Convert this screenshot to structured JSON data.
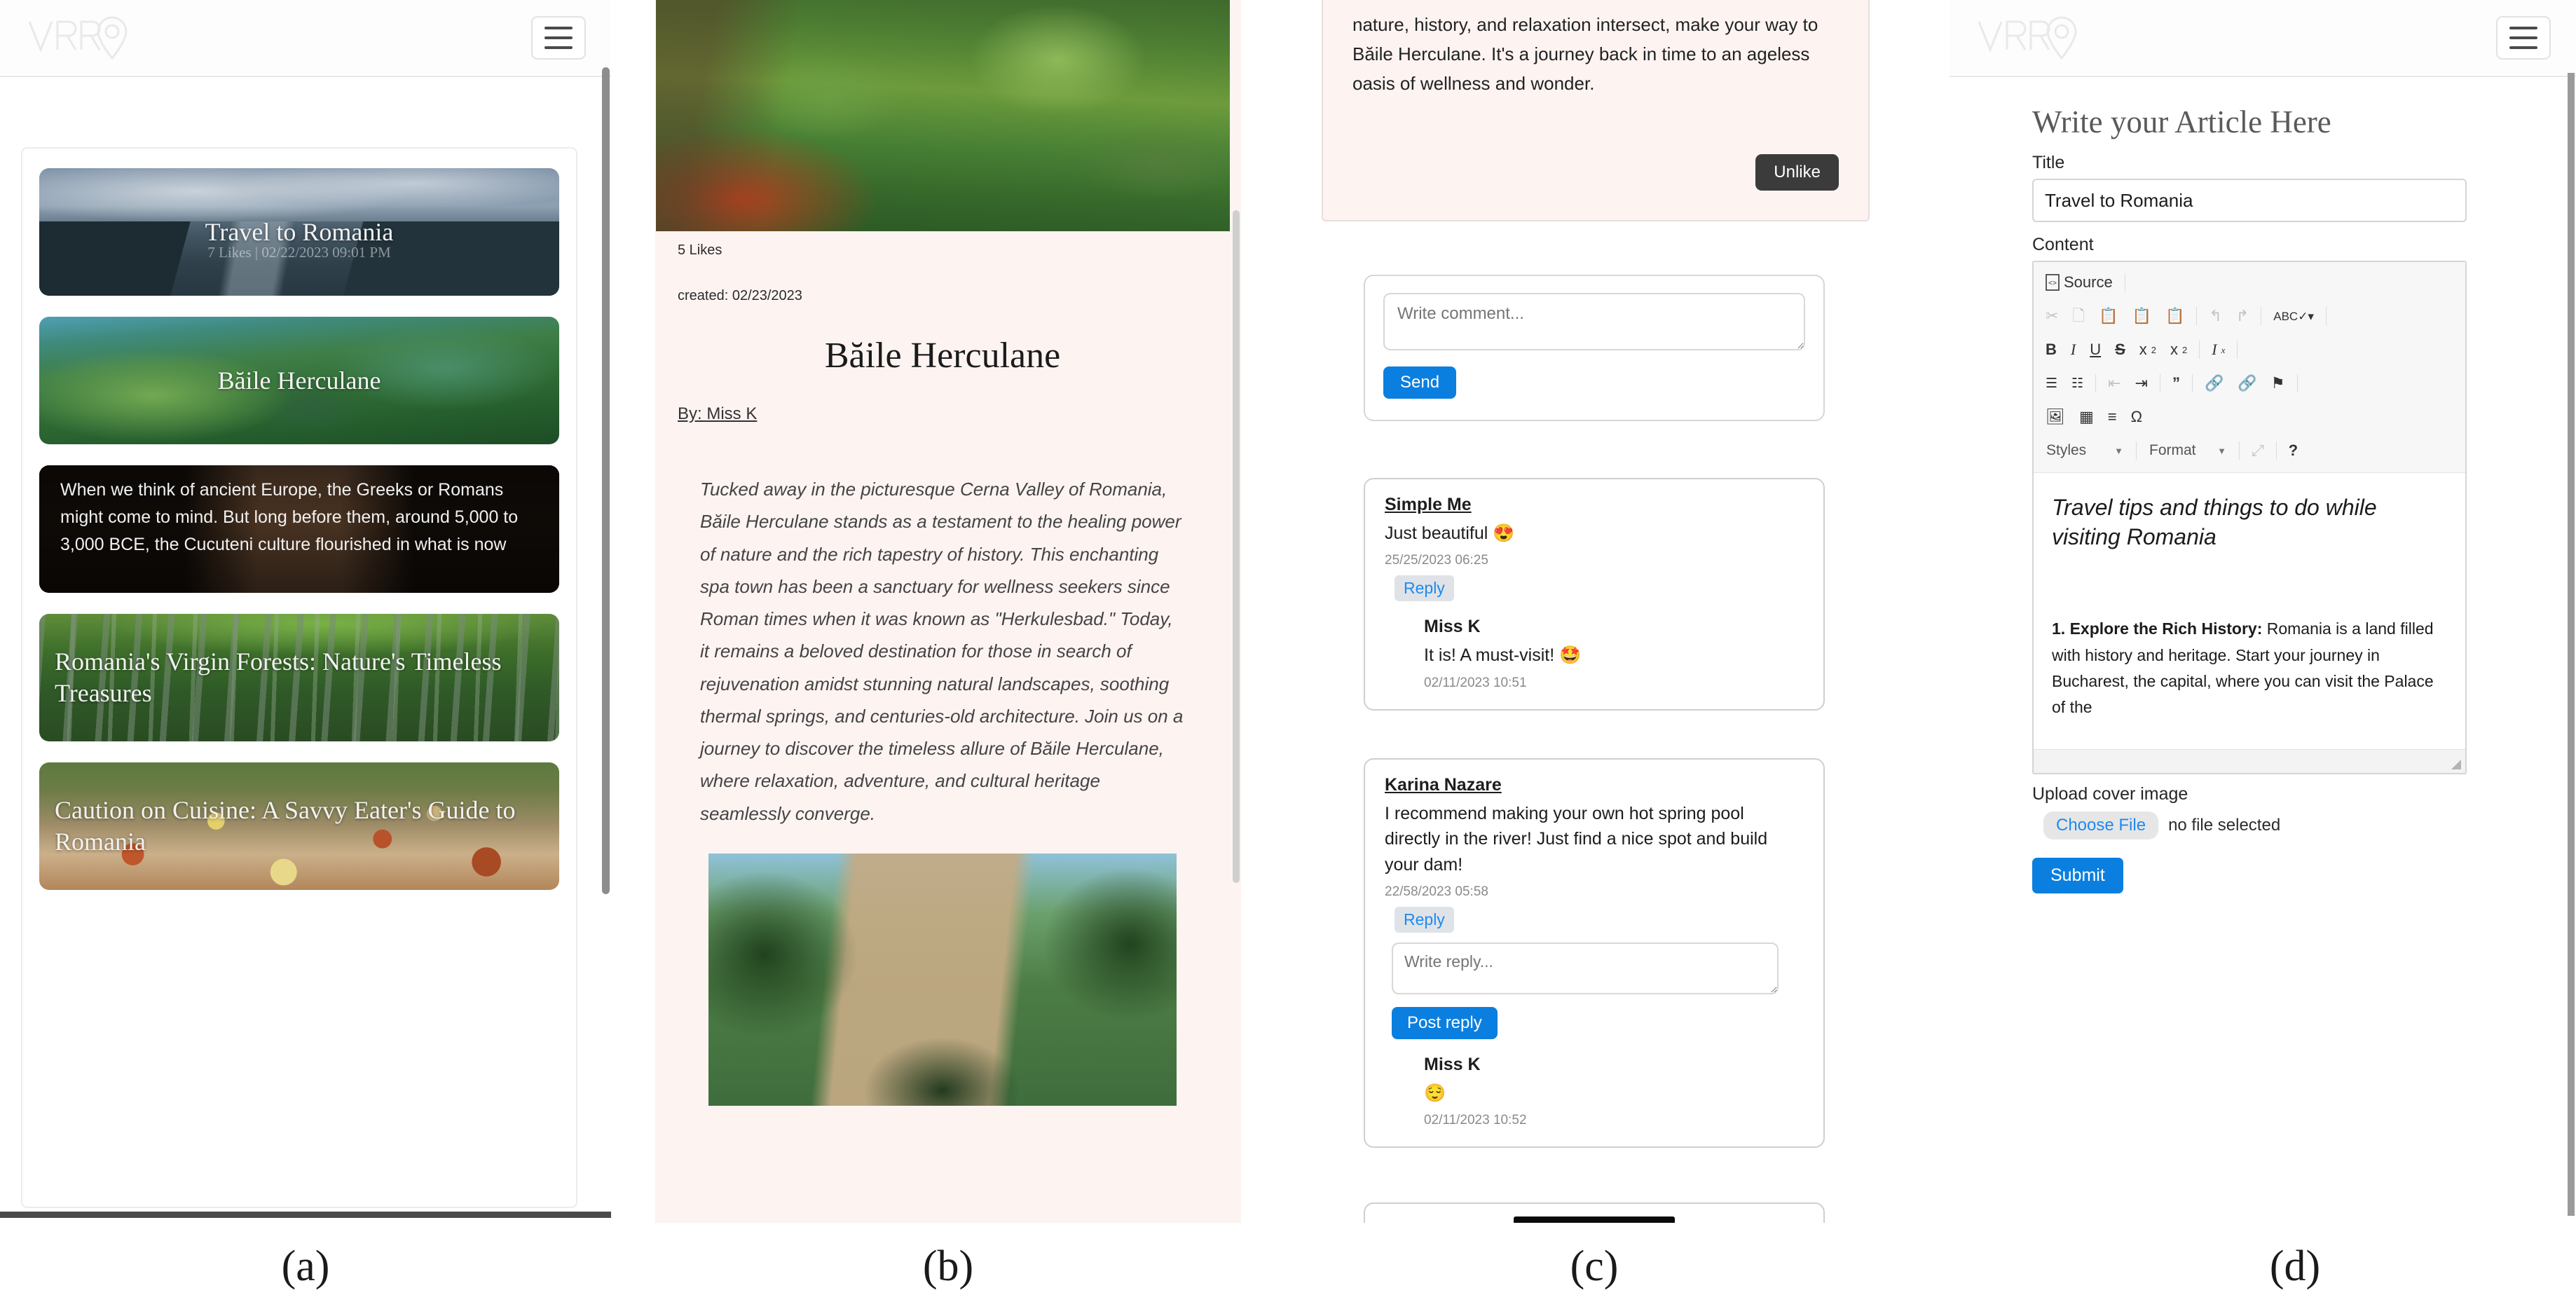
{
  "brand": {
    "logo_text": "VRRO",
    "logo_icon": "map-pin-logo"
  },
  "panel_captions": [
    "(a)",
    "(b)",
    "(c)",
    "(d)"
  ],
  "panel_a": {
    "nav": {
      "logo": "VRRO",
      "menu_icon": "hamburger-menu-icon"
    },
    "tiles": [
      {
        "title": "Travel to Romania",
        "meta": "7 Likes | 02/22/2023 09:01 PM",
        "kind": "photo",
        "align": "center"
      },
      {
        "title": "Băile Herculane",
        "meta": "",
        "kind": "photo",
        "align": "center"
      },
      {
        "title": "When we think of ancient Europe, the Greeks or Romans might come to mind. But long before them, around 5,000 to 3,000 BCE, the Cucuteni culture flourished in what is now",
        "kind": "dark-text"
      },
      {
        "title": "Romania's Virgin Forests: Nature's Timeless Treasures",
        "meta": "",
        "kind": "photo",
        "align": "left"
      },
      {
        "title": "Caution on Cuisine: A Savvy Eater's Guide to Romania",
        "meta": "",
        "kind": "photo",
        "align": "left"
      }
    ]
  },
  "panel_b": {
    "likes": "5 Likes",
    "created": "created: 02/23/2023",
    "title": "Băile Herculane",
    "author": "By: Miss K",
    "body": "Tucked away in the picturesque Cerna Valley of Romania, Băile Herculane stands as a testament to the healing power of nature and the rich tapestry of history. This enchanting spa town has been a sanctuary for wellness seekers since Roman times when it was known as \"Herkulesbad.\" Today, it remains a beloved destination for those in search of rejuvenation amidst stunning natural landscapes, soothing thermal springs, and centuries-old architecture. Join us on a journey to discover the timeless allure of Băile Herculane, where relaxation, adventure, and cultural heritage seamlessly converge."
  },
  "panel_c": {
    "article_tail": "nature, history, and relaxation intersect, make your way to Băile Herculane. It's a journey back in time to an ageless oasis of wellness and wonder.",
    "unlike_label": "Unlike",
    "comment_placeholder": "Write comment...",
    "send_label": "Send",
    "comments": [
      {
        "author": "Simple Me",
        "text": "Just beautiful 😍",
        "time": "25/25/2023 06:25",
        "reply_label": "Reply",
        "replies": [
          {
            "author": "Miss K",
            "text": "It is! A must-visit! 🤩",
            "time": "02/11/2023 10:51"
          }
        ]
      },
      {
        "author": "Karina Nazare",
        "text": "I recommend making your own hot spring pool directly in the river! Just find a nice spot and build your dam!",
        "time": "22/58/2023 05:58",
        "reply_label": "Reply",
        "reply_placeholder": "Write reply...",
        "post_reply_label": "Post reply",
        "replies": [
          {
            "author": "Miss K",
            "text": "😌",
            "time": "02/11/2023 10:52"
          }
        ]
      }
    ]
  },
  "panel_d": {
    "nav": {
      "logo": "VRRO",
      "menu_icon": "hamburger-menu-icon"
    },
    "heading": "Write your Article Here",
    "title_label": "Title",
    "title_value": "Travel to Romania",
    "content_label": "Content",
    "toolbar": {
      "source_label": "Source",
      "row_clipboard": [
        "cut-icon",
        "copy-icon",
        "paste-icon",
        "paste-text-icon",
        "paste-word-icon",
        "undo-icon",
        "redo-icon",
        "spellcheck-icon"
      ],
      "row_format": [
        "bold-icon",
        "italic-icon",
        "underline-icon",
        "strikethrough-icon",
        "subscript-icon",
        "superscript-icon",
        "remove-format-icon"
      ],
      "row_lists": [
        "numbered-list-icon",
        "bulleted-list-icon",
        "decrease-indent-icon",
        "increase-indent-icon",
        "blockquote-icon",
        "link-icon",
        "unlink-icon",
        "anchor-icon"
      ],
      "row_insert": [
        "image-icon",
        "table-icon",
        "horizontal-rule-icon",
        "special-char-icon"
      ],
      "styles_label": "Styles",
      "format_label": "Format",
      "maximize_icon": "maximize-icon",
      "about_label": "?"
    },
    "editor_title": "Travel tips and things to do while visiting Romania",
    "editor_item_number": "1.",
    "editor_item_heading": "Explore the Rich History:",
    "editor_item_text": " Romania is a land filled with history and heritage. Start your journey in Bucharest, the capital, where you can visit the Palace of the",
    "upload_label": "Upload cover image",
    "choose_file_label": "Choose File",
    "no_file_label": "no file selected",
    "submit_label": "Submit"
  }
}
